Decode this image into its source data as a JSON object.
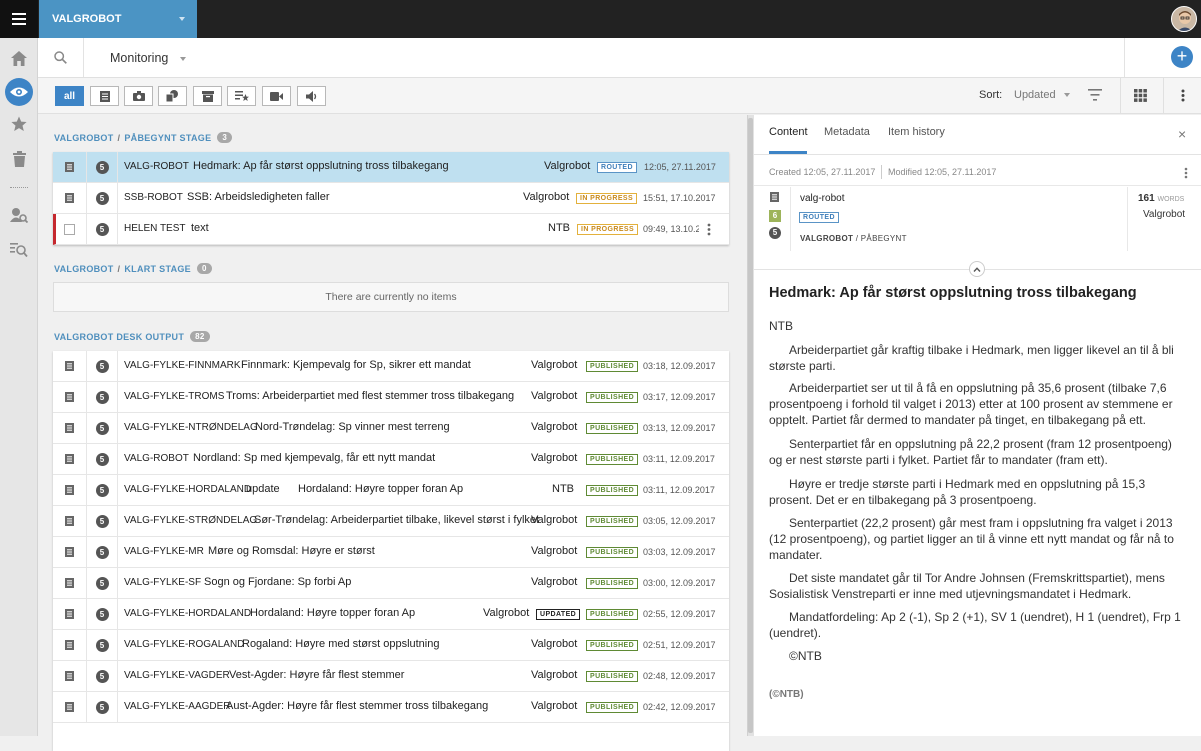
{
  "header": {
    "desk_name": "VALGROBOT"
  },
  "subbar": {
    "view_label": "Monitoring"
  },
  "toolbar": {
    "filter_all": "all",
    "sort_label": "Sort:",
    "sort_value": "Updated"
  },
  "groups": [
    {
      "name": "VALGROBOT",
      "stage": "PÅBEGYNT STAGE",
      "count": "3",
      "rows": [
        {
          "priority": "5",
          "source": "VALG-ROBOT",
          "headline": "Hedmark: Ap får størst oppslutning tross tilbakegang",
          "provider": "Valgrobot",
          "status": "ROUTED",
          "time": "12:05, 27.11.2017"
        },
        {
          "priority": "5",
          "source": "SSB-ROBOT",
          "headline": "SSB: Arbeidsledigheten faller",
          "provider": "Valgrobot",
          "status": "IN PROGRESS",
          "time": "15:51, 17.10.2017"
        },
        {
          "priority": "5",
          "source": "HELEN TEST",
          "headline": "text",
          "provider": "NTB",
          "status": "IN PROGRESS",
          "time": "09:49, 13.10.2"
        }
      ]
    },
    {
      "name": "VALGROBOT",
      "stage": "KLART STAGE",
      "count": "0",
      "empty_text": "There are currently no items"
    },
    {
      "name": "VALGROBOT DESK OUTPUT",
      "count": "82",
      "rows": [
        {
          "priority": "5",
          "source": "VALG-FYLKE-FINNMARK",
          "headline": "Finnmark: Kjempevalg for Sp, sikrer ett mandat",
          "provider": "Valgrobot",
          "status": "PUBLISHED",
          "time": "03:18, 12.09.2017"
        },
        {
          "priority": "5",
          "source": "VALG-FYLKE-TROMS",
          "headline": "Troms: Arbeiderpartiet med flest stemmer tross tilbakegang",
          "provider": "Valgrobot",
          "status": "PUBLISHED",
          "time": "03:17, 12.09.2017"
        },
        {
          "priority": "5",
          "source": "VALG-FYLKE-NTRØNDELAG",
          "headline": "Nord-Trøndelag: Sp vinner mest terreng",
          "provider": "Valgrobot",
          "status": "PUBLISHED",
          "time": "03:13, 12.09.2017"
        },
        {
          "priority": "5",
          "source": "VALG-ROBOT",
          "headline": "Nordland: Sp med kjempevalg, får ett nytt mandat",
          "provider": "Valgrobot",
          "status": "PUBLISHED",
          "time": "03:11, 12.09.2017"
        },
        {
          "priority": "5",
          "source": "VALG-FYLKE-HORDALAND",
          "slugline": "update",
          "headline": "Hordaland: Høyre topper foran Ap",
          "provider": "NTB",
          "status": "PUBLISHED",
          "time": "03:11, 12.09.2017"
        },
        {
          "priority": "5",
          "source": "VALG-FYLKE-STRØNDELAG",
          "headline": "Sør-Trøndelag: Arbeiderpartiet tilbake, likevel størst i fylket",
          "provider": "Valgrobot",
          "status": "PUBLISHED",
          "time": "03:05, 12.09.2017"
        },
        {
          "priority": "5",
          "source": "VALG-FYLKE-MR",
          "headline": "Møre og Romsdal: Høyre er størst",
          "provider": "Valgrobot",
          "status": "PUBLISHED",
          "time": "03:03, 12.09.2017"
        },
        {
          "priority": "5",
          "source": "VALG-FYLKE-SF",
          "headline": "Sogn og Fjordane: Sp forbi Ap",
          "provider": "Valgrobot",
          "status": "PUBLISHED",
          "time": "03:00, 12.09.2017"
        },
        {
          "priority": "5",
          "source": "VALG-FYLKE-HORDALAND",
          "headline": "Hordaland: Høyre topper foran Ap",
          "provider": "Valgrobot",
          "status2": "UPDATED",
          "status": "PUBLISHED",
          "time": "02:55, 12.09.2017"
        },
        {
          "priority": "5",
          "source": "VALG-FYLKE-ROGALAND",
          "headline": "Rogaland: Høyre med størst oppslutning",
          "provider": "Valgrobot",
          "status": "PUBLISHED",
          "time": "02:51, 12.09.2017"
        },
        {
          "priority": "5",
          "source": "VALG-FYLKE-VAGDER",
          "headline": "Vest-Agder: Høyre får flest stemmer",
          "provider": "Valgrobot",
          "status": "PUBLISHED",
          "time": "02:48, 12.09.2017"
        },
        {
          "priority": "5",
          "source": "VALG-FYLKE-AAGDER",
          "headline": "Aust-Agder: Høyre får flest stemmer tross tilbakegang",
          "provider": "Valgrobot",
          "status": "PUBLISHED",
          "time": "02:42, 12.09.2017"
        }
      ]
    }
  ],
  "preview": {
    "tabs": [
      "Content",
      "Metadata",
      "Item history"
    ],
    "created": "Created 12:05, 27.11.2017",
    "modified": "Modified 12:05, 27.11.2017",
    "urgency": "6",
    "priority": "5",
    "source": "valg-robot",
    "status": "ROUTED",
    "desk": "VALGROBOT",
    "stage": "PÅBEGYNT",
    "word_count": "161",
    "word_label": "WORDS",
    "provider": "Valgrobot",
    "headline": "Hedmark: Ap får størst oppslutning tross tilbakegang",
    "byline": "NTB",
    "body": [
      "Arbeiderpartiet går kraftig tilbake i Hedmark, men ligger likevel an til å bli største parti.",
      "Arbeiderpartiet ser ut til å få en oppslutning på 35,6 prosent (tilbake 7,6 prosentpoeng i forhold til valget i 2013) etter at 100 prosent av stemmene er opptelt. Partiet får dermed to mandater på tinget, en tilbakegang på ett.",
      "Senterpartiet får en oppslutning på 22,2 prosent (fram 12 prosentpoeng) og er nest største parti i fylket. Partiet får to mandater (fram ett).",
      "Høyre er tredje største parti i Hedmark med en oppslutning på 15,3 prosent. Det er en tilbakegang på 3 prosentpoeng.",
      "Senterpartiet (22,2 prosent) går mest fram i oppslutning fra valget i 2013 (12 prosentpoeng), og partiet ligger an til å vinne ett nytt mandat og får nå to mandater.",
      "Det siste mandatet går til Tor Andre Johnsen (Fremskrittspartiet), mens Sosialistisk Venstreparti er inne med utjevningsmandatet i Hedmark.",
      "Mandatfordeling: Ap 2 (-1), Sp 2 (+1), SV 1 (uendret), H 1 (uendret), Frp 1 (uendret).",
      "©NTB"
    ],
    "footer": "(©NTB)"
  }
}
